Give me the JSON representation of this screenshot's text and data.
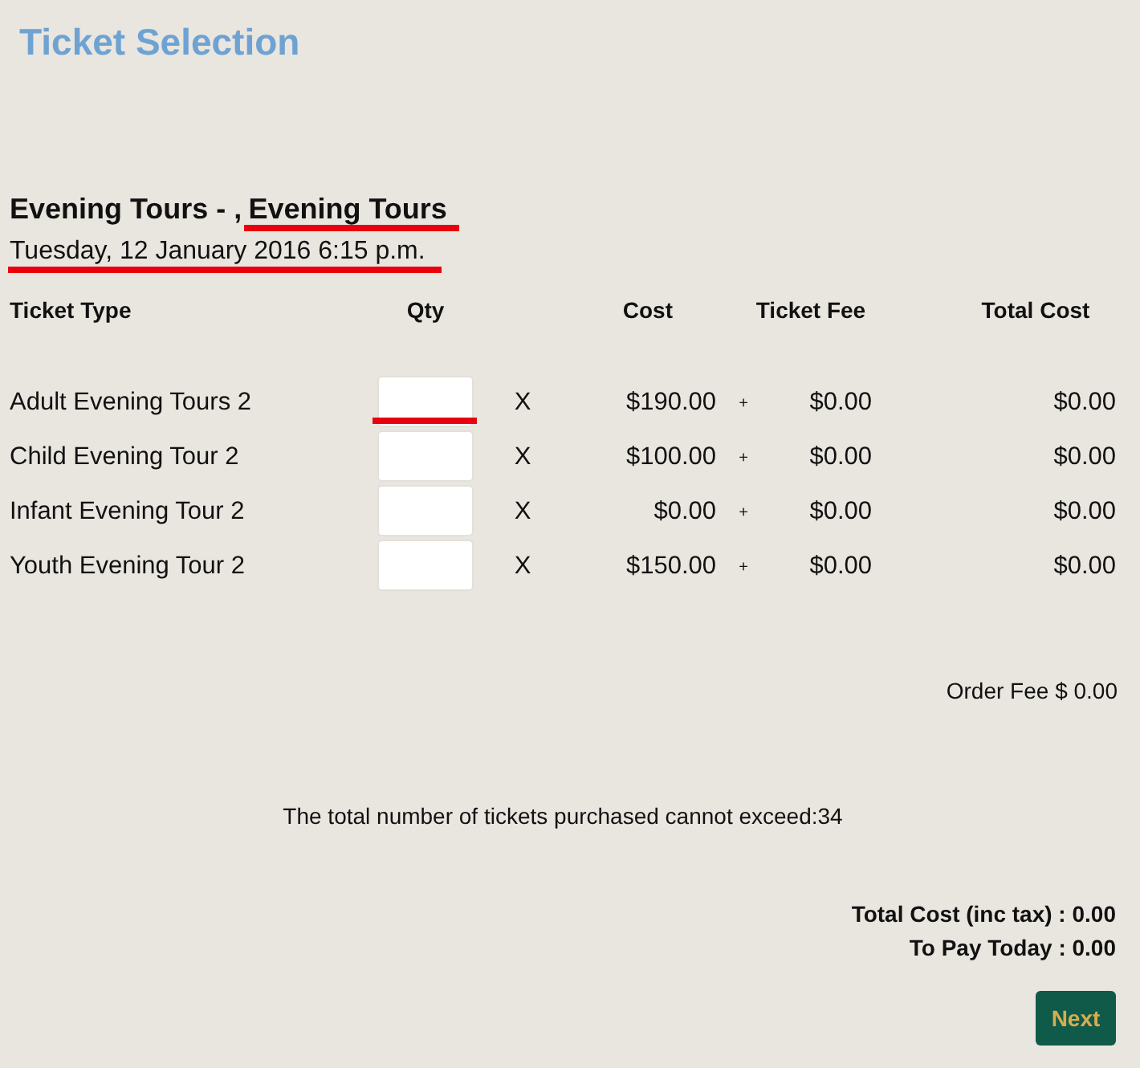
{
  "header": {
    "title": "Ticket Selection"
  },
  "event": {
    "title": "Evening Tours - ,",
    "name": "Evening Tours",
    "name_underlined": true,
    "date": "Tuesday, 12 January 2016 6:15 p.m.",
    "date_underlined": true
  },
  "table": {
    "columns": [
      "Ticket Type",
      "Qty",
      "Cost",
      "Ticket Fee",
      "Total Cost"
    ],
    "rows": [
      {
        "ticket_type": "Adult Evening Tours 2",
        "qty_underlined": true,
        "times": "X",
        "cost": "$190.00",
        "plus": "+",
        "fee": "$0.00",
        "total": "$0.00"
      },
      {
        "ticket_type": "Child Evening Tour 2",
        "qty_underlined": false,
        "times": "X",
        "cost": "$100.00",
        "plus": "+",
        "fee": "$0.00",
        "total": "$0.00"
      },
      {
        "ticket_type": "Infant Evening Tour 2",
        "qty_underlined": false,
        "times": "X",
        "cost": "$0.00",
        "plus": "+",
        "fee": "$0.00",
        "total": "$0.00"
      },
      {
        "ticket_type": "Youth Evening Tour 2",
        "qty_underlined": false,
        "times": "X",
        "cost": "$150.00",
        "plus": "+",
        "fee": "$0.00",
        "total": "$0.00"
      }
    ]
  },
  "order_fee": "Order Fee $ 0.00",
  "limit_message": "The total number of tickets purchased cannot exceed:34",
  "totals": [
    "Total Cost (inc tax) : 0.00",
    "To Pay Today : 0.00"
  ],
  "next_button": "Next"
}
